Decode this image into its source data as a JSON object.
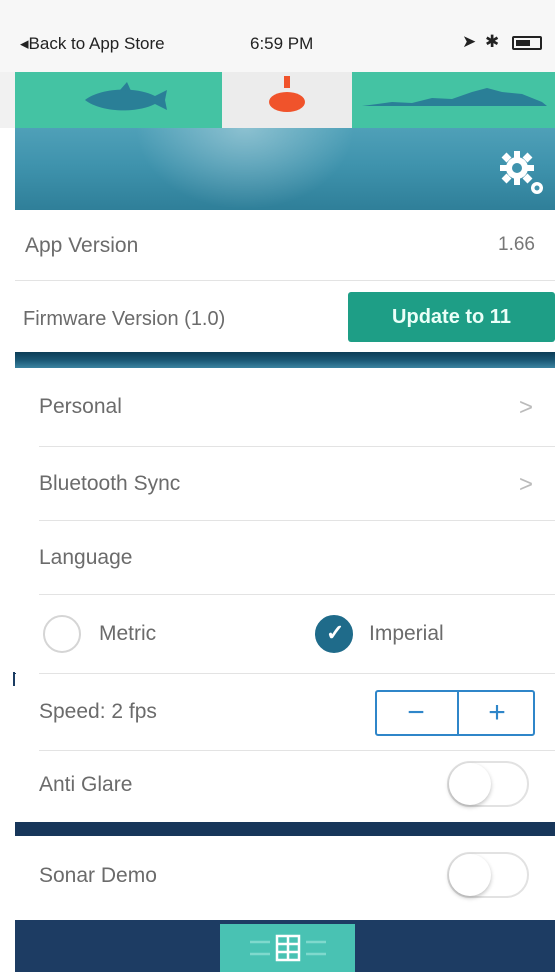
{
  "status_bar": {
    "back_label": "◂Back to App Store",
    "time": "6:59 PM",
    "icons": "➤ ✱"
  },
  "tabs": [
    {
      "name": "fish"
    },
    {
      "name": "bobber"
    },
    {
      "name": "terrain"
    }
  ],
  "settings_icon": "gear-icon",
  "info": {
    "app_version_label": "App Version",
    "app_version_value": "1.66",
    "firmware_label": "Firmware Version (1.0)",
    "update_button_label": "Update to 11"
  },
  "menu": {
    "personal": "Personal",
    "bluetooth_sync": "Bluetooth Sync",
    "language": "Language",
    "chevron": ">"
  },
  "units": {
    "metric_label": "Metric",
    "imperial_label": "Imperial",
    "selected": "Imperial"
  },
  "speed": {
    "label": "Speed: 2 fps",
    "minus": "−",
    "plus": "+"
  },
  "toggles": {
    "anti_glare_label": "Anti Glare",
    "anti_glare_on": false,
    "sonar_demo_label": "Sonar Demo",
    "sonar_demo_on": false
  },
  "colors": {
    "accent_teal": "#44c3a3",
    "update_green": "#1e9e86",
    "navy": "#1d3c63",
    "stepper_blue": "#2f86c9",
    "ocean": "#3f93ad"
  }
}
